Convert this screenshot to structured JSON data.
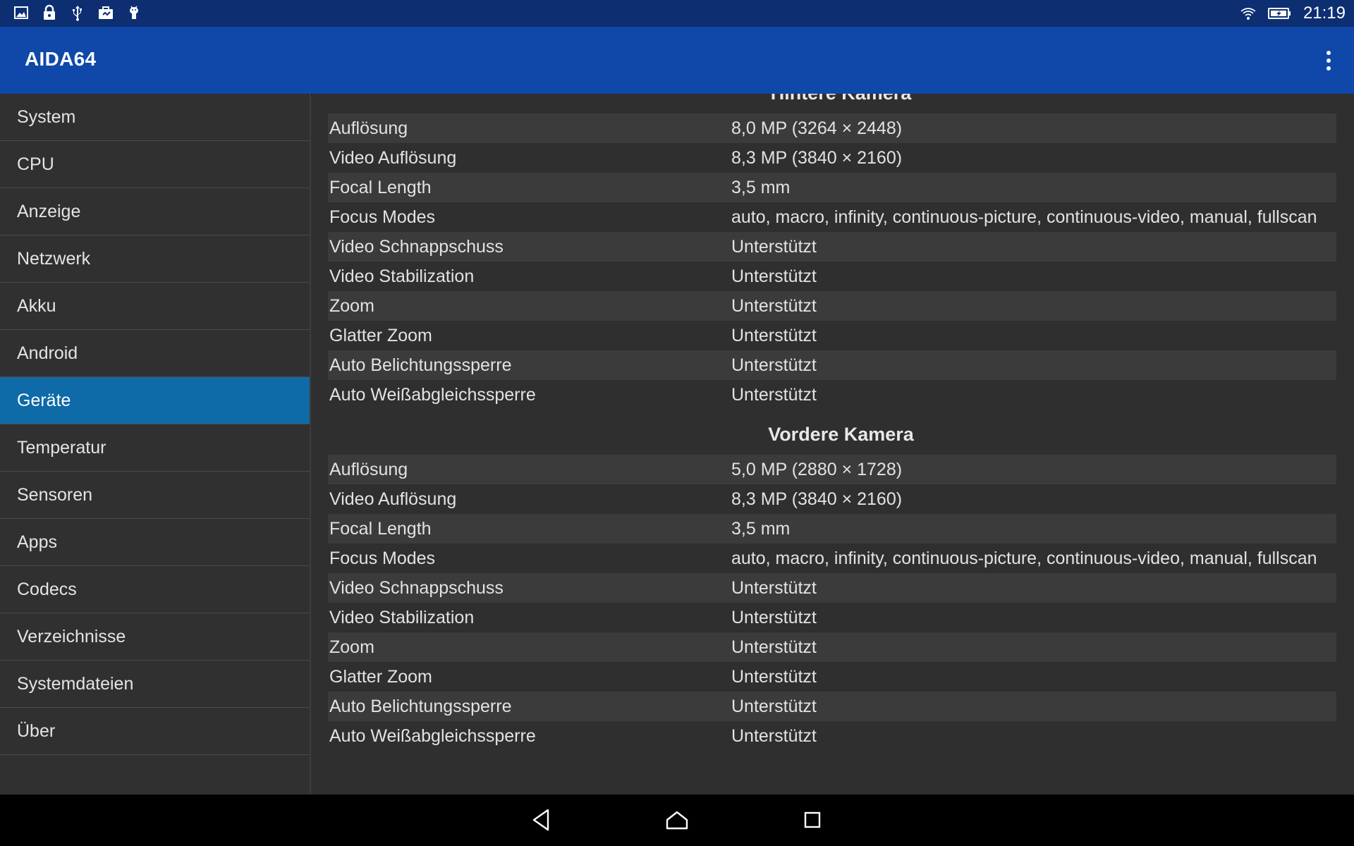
{
  "status_bar": {
    "icons_left": [
      "image-icon",
      "lock-icon",
      "usb-icon",
      "briefcase-icon",
      "android-debug-icon"
    ],
    "icons_right": [
      "wifi-icon",
      "battery-charging-icon"
    ],
    "time": "21:19"
  },
  "app_bar": {
    "title": "AIDA64",
    "menu_icon": "more-vert-icon"
  },
  "sidebar": {
    "items": [
      {
        "label": "System",
        "active": false
      },
      {
        "label": "CPU",
        "active": false
      },
      {
        "label": "Anzeige",
        "active": false
      },
      {
        "label": "Netzwerk",
        "active": false
      },
      {
        "label": "Akku",
        "active": false
      },
      {
        "label": "Android",
        "active": false
      },
      {
        "label": "Geräte",
        "active": true
      },
      {
        "label": "Temperatur",
        "active": false
      },
      {
        "label": "Sensoren",
        "active": false
      },
      {
        "label": "Apps",
        "active": false
      },
      {
        "label": "Codecs",
        "active": false
      },
      {
        "label": "Verzeichnisse",
        "active": false
      },
      {
        "label": "Systemdateien",
        "active": false
      },
      {
        "label": "Über",
        "active": false
      }
    ]
  },
  "content": {
    "rear_camera": {
      "title": "Hintere Kamera",
      "rows": [
        {
          "key": "Auflösung",
          "value": "8,0 MP (3264 × 2448)"
        },
        {
          "key": "Video Auflösung",
          "value": "8,3 MP (3840 × 2160)"
        },
        {
          "key": "Focal Length",
          "value": "3,5 mm"
        },
        {
          "key": "Focus Modes",
          "value": "auto, macro, infinity, continuous-picture, continuous-video, manual, fullscan"
        },
        {
          "key": "Video Schnappschuss",
          "value": "Unterstützt"
        },
        {
          "key": "Video Stabilization",
          "value": "Unterstützt"
        },
        {
          "key": "Zoom",
          "value": "Unterstützt"
        },
        {
          "key": "Glatter Zoom",
          "value": "Unterstützt"
        },
        {
          "key": "Auto Belichtungssperre",
          "value": "Unterstützt"
        },
        {
          "key": "Auto Weißabgleichssperre",
          "value": "Unterstützt"
        }
      ]
    },
    "front_camera": {
      "title": "Vordere Kamera",
      "rows": [
        {
          "key": "Auflösung",
          "value": "5,0 MP (2880 × 1728)"
        },
        {
          "key": "Video Auflösung",
          "value": "8,3 MP (3840 × 2160)"
        },
        {
          "key": "Focal Length",
          "value": "3,5 mm"
        },
        {
          "key": "Focus Modes",
          "value": "auto, macro, infinity, continuous-picture, continuous-video, manual, fullscan"
        },
        {
          "key": "Video Schnappschuss",
          "value": "Unterstützt"
        },
        {
          "key": "Video Stabilization",
          "value": "Unterstützt"
        },
        {
          "key": "Zoom",
          "value": "Unterstützt"
        },
        {
          "key": "Glatter Zoom",
          "value": "Unterstützt"
        },
        {
          "key": "Auto Belichtungssperre",
          "value": "Unterstützt"
        },
        {
          "key": "Auto Weißabgleichssperre",
          "value": "Unterstützt"
        }
      ]
    }
  },
  "nav_bar": {
    "buttons": [
      "back-icon",
      "home-icon",
      "recents-icon"
    ]
  },
  "colors": {
    "status_bar": "#0d2f72",
    "app_bar": "#0f48a8",
    "active_item": "#0f6aa8",
    "background": "#303030"
  }
}
